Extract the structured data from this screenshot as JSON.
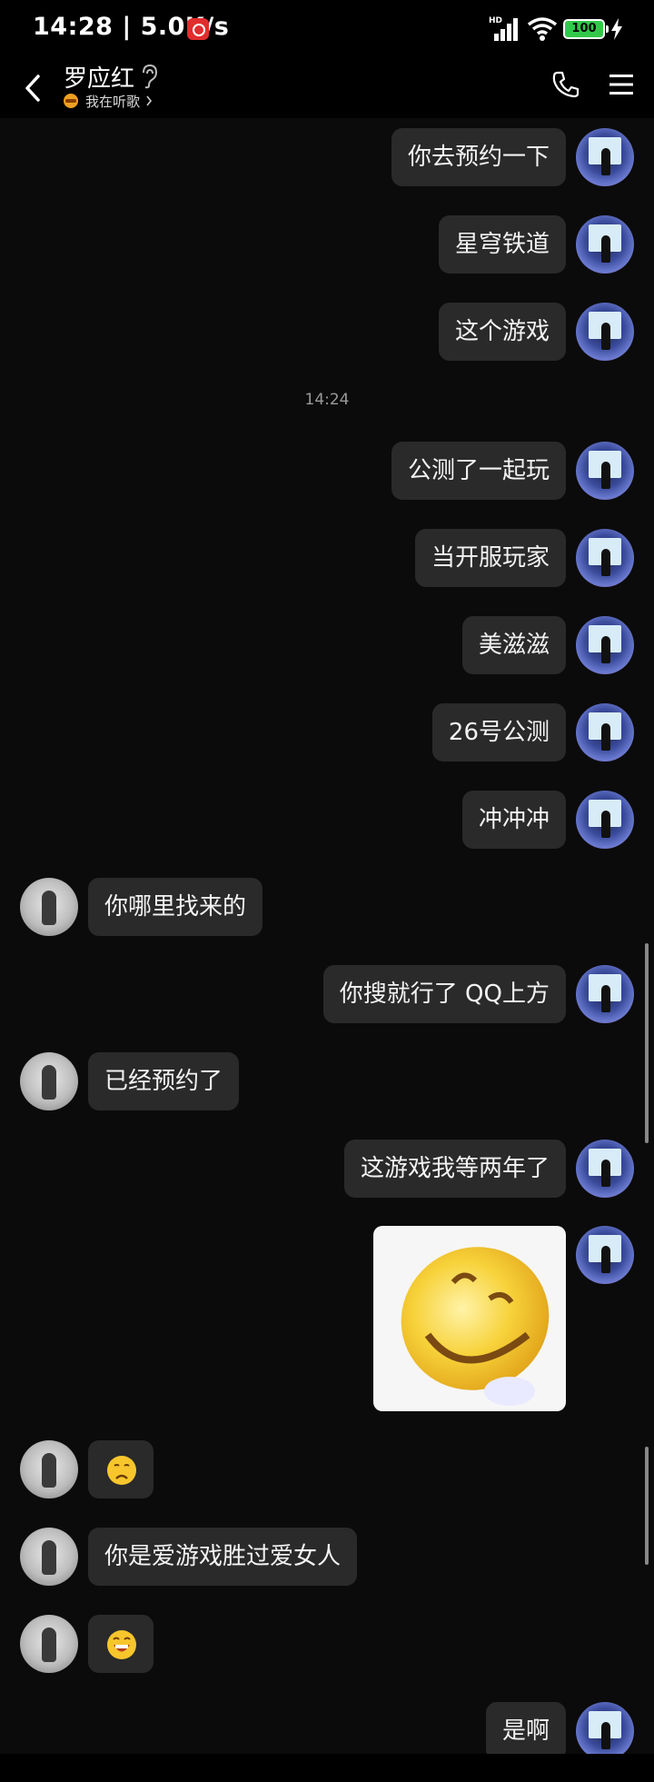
{
  "status_bar": {
    "time_speed": "14:28 | 5.0K/s",
    "network_label": "HD",
    "battery_level": "100"
  },
  "header": {
    "contact_name": "罗应红",
    "music_status": "我在听歌"
  },
  "messages": [
    {
      "side": "right",
      "text": "你去预约一下"
    },
    {
      "side": "right",
      "text": "星穹铁道"
    },
    {
      "side": "right",
      "text": "这个游戏"
    },
    {
      "type": "time",
      "text": "14:24"
    },
    {
      "side": "right",
      "text": "公测了一起玩"
    },
    {
      "side": "right",
      "text": "当开服玩家"
    },
    {
      "side": "right",
      "text": "美滋滋"
    },
    {
      "side": "right",
      "text": "26号公测"
    },
    {
      "side": "right",
      "text": "冲冲冲"
    },
    {
      "side": "left",
      "text": "你哪里找来的"
    },
    {
      "side": "right",
      "text": "你搜就行了 QQ上方"
    },
    {
      "side": "left",
      "text": "已经预约了"
    },
    {
      "side": "right",
      "text": "这游戏我等两年了"
    },
    {
      "side": "right",
      "type": "sticker",
      "sticker": "laughing-face-sticker"
    },
    {
      "side": "left",
      "type": "emoji",
      "emoji": "frown-emoji"
    },
    {
      "side": "left",
      "text": "你是爱游戏胜过爱女人"
    },
    {
      "side": "left",
      "type": "emoji",
      "emoji": "grin-emoji"
    },
    {
      "side": "right",
      "text": "是啊"
    }
  ],
  "colors": {
    "background": "#0b0b0b",
    "bubble": "#2a2a2a",
    "battery": "#32c94a",
    "emoji_yellow": "#f7c62d"
  }
}
